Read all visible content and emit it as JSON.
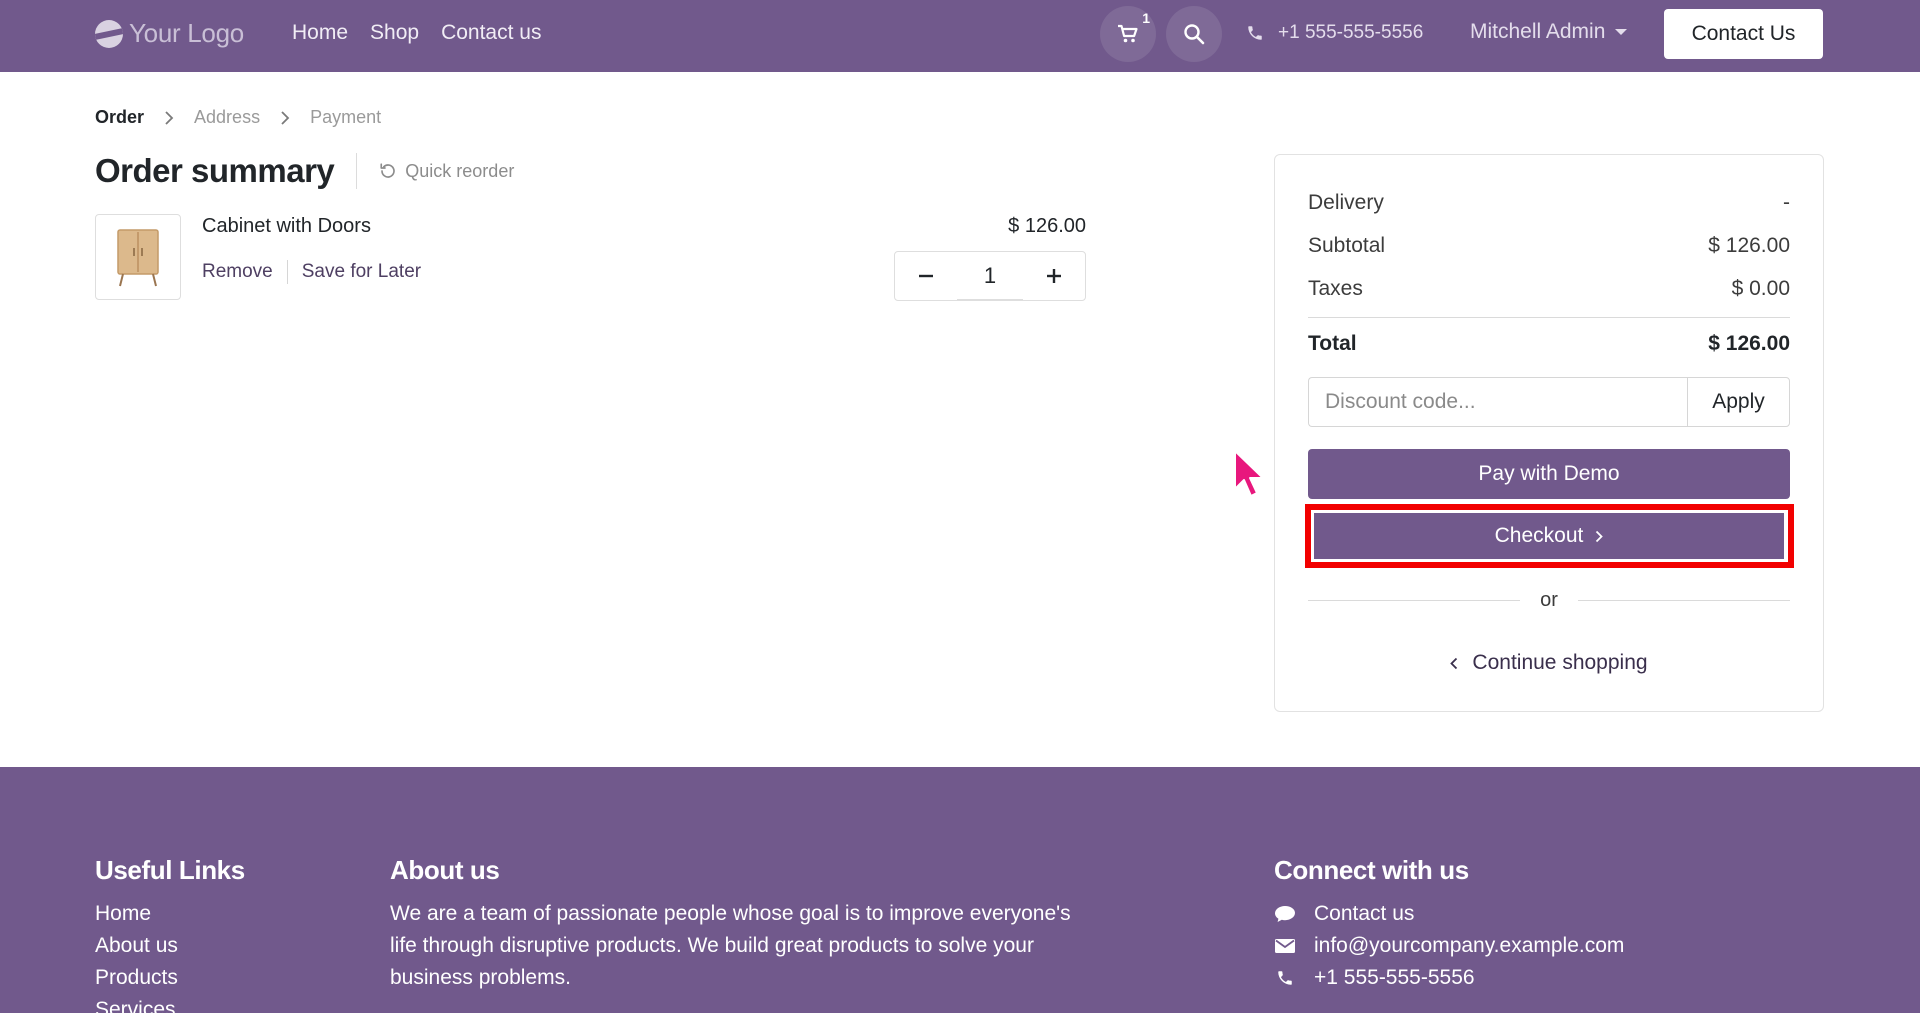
{
  "header": {
    "logo_text": "Your Logo",
    "nav": [
      "Home",
      "Shop",
      "Contact us"
    ],
    "cart_count": "1",
    "phone": "+1 555-555-5556",
    "user": "Mitchell Admin",
    "contact_button": "Contact Us"
  },
  "breadcrumb": [
    "Order",
    "Address",
    "Payment"
  ],
  "order": {
    "title": "Order summary",
    "quick_reorder": "Quick reorder",
    "product": {
      "name": "Cabinet with Doors",
      "remove": "Remove",
      "save_for_later": "Save for Later",
      "price": "$ 126.00",
      "quantity": "1"
    }
  },
  "summary": {
    "delivery_label": "Delivery",
    "delivery_value": "-",
    "subtotal_label": "Subtotal",
    "subtotal_value": "$ 126.00",
    "taxes_label": "Taxes",
    "taxes_value": "$ 0.00",
    "total_label": "Total",
    "total_value": "$ 126.00",
    "discount_placeholder": "Discount code...",
    "apply": "Apply",
    "pay_button": "Pay with Demo",
    "checkout_button": "Checkout",
    "or": "or",
    "continue_shopping": "Continue shopping"
  },
  "footer": {
    "useful_links_title": "Useful Links",
    "useful_links": [
      "Home",
      "About us",
      "Products",
      "Services"
    ],
    "about_title": "About us",
    "about_text": "We are a team of passionate people whose goal is to improve everyone's life through disruptive products. We build great products to solve your business problems.",
    "connect_title": "Connect with us",
    "connect_contact": "Contact us",
    "connect_email": "info@yourcompany.example.com",
    "connect_phone": "+1 555-555-5556"
  },
  "colors": {
    "brand": "#71598c",
    "highlight": "#f20000",
    "cursor": "#e8177d"
  }
}
